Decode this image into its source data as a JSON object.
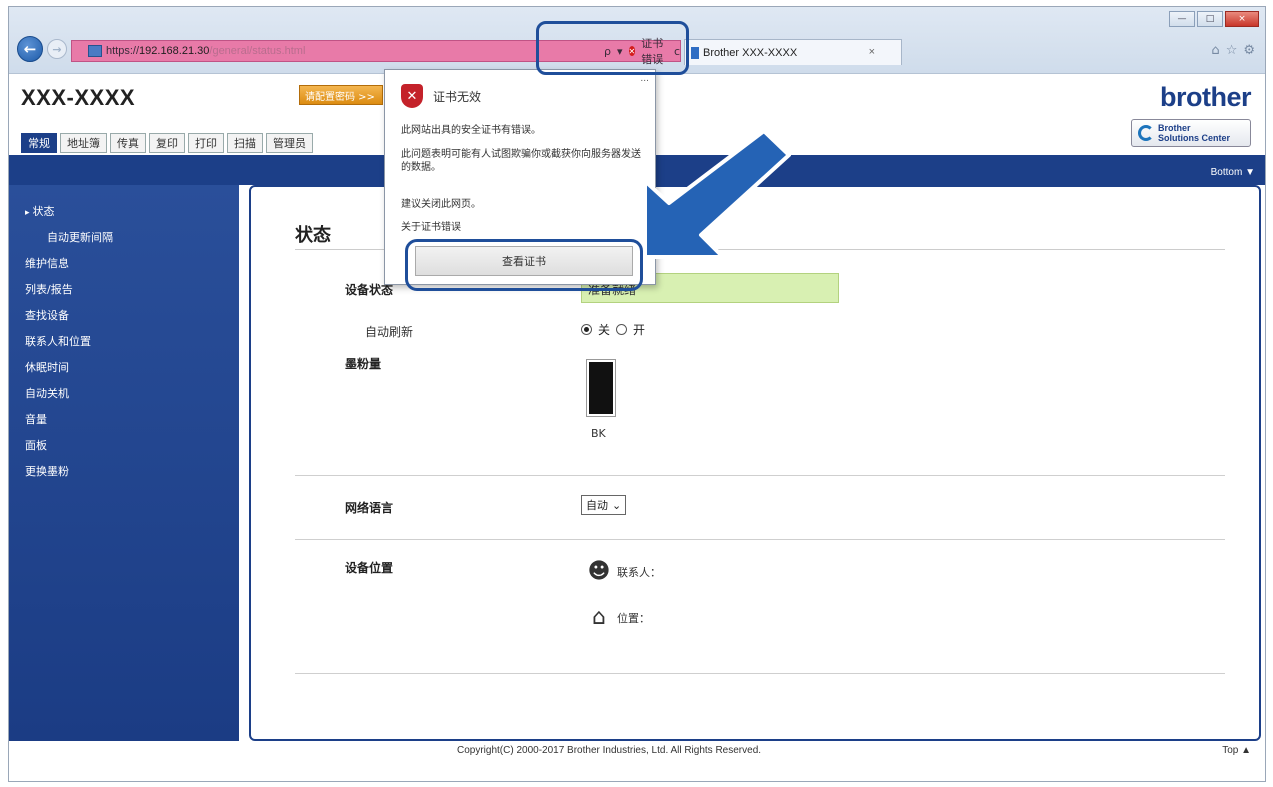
{
  "browser": {
    "url_prefix": "https://",
    "url_host": "192.168.21.30",
    "url_path": "/general/status.html",
    "search_symbol": "ρ",
    "dropdown_symbol": "▾",
    "cert_error_label": "证书错误",
    "refresh_symbol": "c",
    "tab_title": "Brother XXX-XXXX",
    "tab_close": "×",
    "window_minimize": "—",
    "window_maximize": "□",
    "window_close": "×",
    "home_icon": "⌂",
    "favorites_icon": "☆",
    "tools_icon": "⚙",
    "back_symbol": "←",
    "forward_symbol": "→"
  },
  "header": {
    "model": "XXX-XXXX",
    "password_warning": "请配置密码 >>",
    "brand": "brother",
    "solutions_center_line1": "Brother",
    "solutions_center_line2": "Solutions Center",
    "bottom_link": "Bottom ▼"
  },
  "tabs": [
    "常规",
    "地址簿",
    "传真",
    "复印",
    "打印",
    "扫描",
    "管理员"
  ],
  "sidebar": {
    "items": [
      {
        "label": "状态",
        "sub": false,
        "current": true
      },
      {
        "label": "自动更新间隔",
        "sub": true,
        "current": false
      },
      {
        "label": "维护信息",
        "sub": false,
        "current": false
      },
      {
        "label": "列表/报告",
        "sub": false,
        "current": false
      },
      {
        "label": "查找设备",
        "sub": false,
        "current": false
      },
      {
        "label": "联系人和位置",
        "sub": false,
        "current": false
      },
      {
        "label": "休眠时间",
        "sub": false,
        "current": false
      },
      {
        "label": "自动关机",
        "sub": false,
        "current": false
      },
      {
        "label": "音量",
        "sub": false,
        "current": false
      },
      {
        "label": "面板",
        "sub": false,
        "current": false
      },
      {
        "label": "更换墨粉",
        "sub": false,
        "current": false
      }
    ]
  },
  "main": {
    "title": "状态",
    "device_status_label": "设备状态",
    "device_status_value": "准备就绪",
    "auto_refresh_label": "自动刷新",
    "auto_refresh_off": "关",
    "auto_refresh_on": "开",
    "toner_label": "墨粉量",
    "toner_color": "BK",
    "toner_level": 1.0,
    "language_label": "网络语言",
    "language_value": "自动",
    "location_label": "设备位置",
    "contact_label": "联系人：",
    "location_field_label": "位置："
  },
  "footer": {
    "copyright": "Copyright(C) 2000-2017 Brother Industries, Ltd. All Rights Reserved.",
    "top_link": "Top ▲"
  },
  "cert_popup": {
    "title": "证书无效",
    "line1": "此网站出具的安全证书有错误。",
    "line2": "此问题表明可能有人试图欺骗你或截获你向服务器发送的数据。",
    "line3": "建议关闭此网页。",
    "about_link": "关于证书错误",
    "view_button": "查看证书",
    "dots": "..."
  },
  "colors": {
    "brand_blue": "#1c3f88",
    "address_bar_error": "#e87aa8",
    "status_green": "#d8f0b2",
    "highlight_blue": "#1f4e9a"
  }
}
